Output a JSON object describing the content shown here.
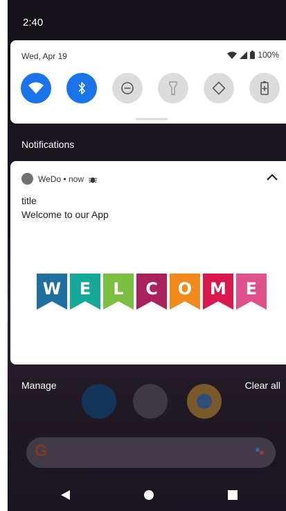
{
  "status_bar": {
    "time": "2:40"
  },
  "quick_settings": {
    "date": "Wed, Apr 19",
    "battery": "100%",
    "tiles": [
      {
        "name": "wifi",
        "state": "on"
      },
      {
        "name": "bluetooth",
        "state": "on"
      },
      {
        "name": "do-not-disturb",
        "state": "off"
      },
      {
        "name": "flashlight",
        "state": "off"
      },
      {
        "name": "auto-rotate",
        "state": "off"
      },
      {
        "name": "battery-saver",
        "state": "off"
      }
    ]
  },
  "notifications": {
    "header": "Notifications",
    "card": {
      "app_name": "WeDo • now",
      "title": "title",
      "text": "Welcome to our App",
      "banner_letters": [
        "W",
        "E",
        "L",
        "C",
        "O",
        "M",
        "E"
      ],
      "banner_colors": [
        "#1f6fa0",
        "#17a89a",
        "#7cbe3f",
        "#a9225e",
        "#f08a1d",
        "#d9174f",
        "#e0508a"
      ]
    },
    "manage_label": "Manage",
    "clear_all_label": "Clear all"
  },
  "colors": {
    "accent": "#1a73e8"
  }
}
